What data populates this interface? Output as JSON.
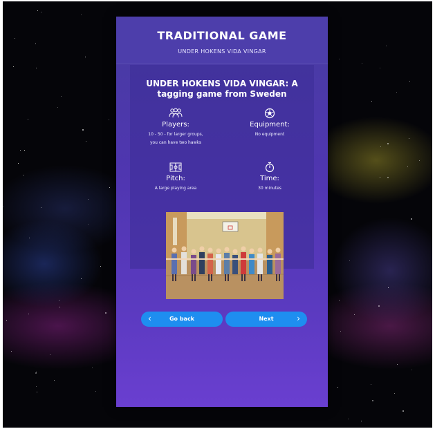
{
  "header": {
    "title": "TRADITIONAL GAME",
    "subtitle": "UNDER HOKENS VIDA VINGAR"
  },
  "game": {
    "title_line1": "UNDER HOKENS VIDA VINGAR: A",
    "title_line2": "tagging game from Sweden",
    "players": {
      "icon": "players-icon",
      "label": "Players:",
      "value_line1": "10 - 50 - for larger groups,",
      "value_line2": "you can have two hawks"
    },
    "equipment": {
      "icon": "ball-icon",
      "label": "Equipment:",
      "value": "No equipment"
    },
    "pitch": {
      "icon": "pitch-icon",
      "label": "Pitch:",
      "value": "A large playing area"
    },
    "time": {
      "icon": "stopwatch-icon",
      "label": "Time:",
      "value": "30 minutes"
    }
  },
  "navigation": {
    "back_label": "Go back",
    "next_label": "Next"
  },
  "colors": {
    "panel": "#4f36b0",
    "button": "#1e8ef0"
  }
}
